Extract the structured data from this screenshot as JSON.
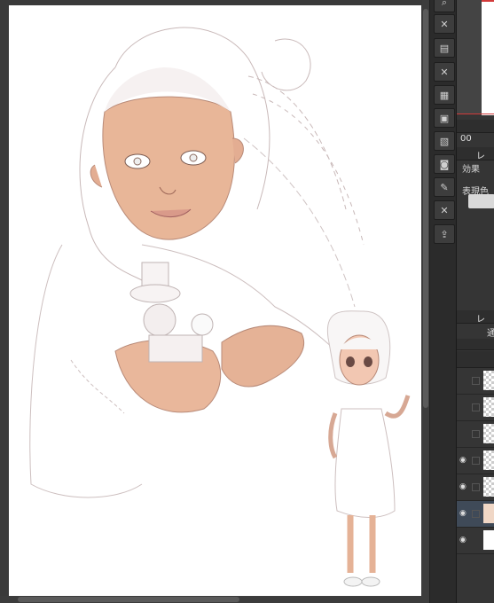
{
  "panel": {
    "effect_label": "効果",
    "display_color_label": "表現色",
    "layer_tab_label": "レ",
    "layer_tab2_label": "レ",
    "opacity_value": "00",
    "blend_label": "通"
  },
  "colors": {
    "accent": "#d23a3a",
    "ui_bg": "#2f2f2f",
    "active_layer": "#3f4a58"
  },
  "commands": [
    "zoom-icon",
    "clear-icon",
    "fill-icon",
    "clear-outside-icon",
    "tone-icon",
    "new-layer-icon",
    "transform-icon",
    "snapshot-icon",
    "edit-icon",
    "delete-icon",
    "export-icon"
  ]
}
